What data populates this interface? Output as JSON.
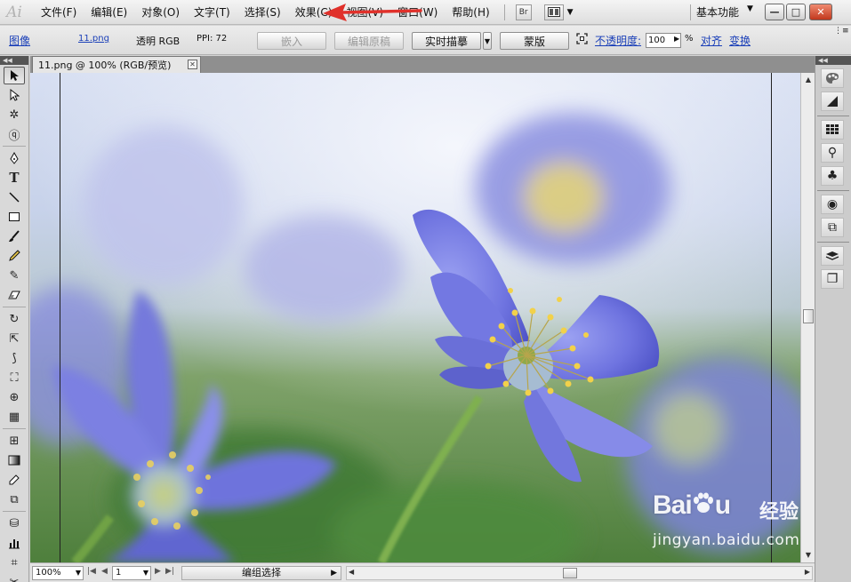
{
  "app": {
    "logo": "Ai"
  },
  "menubar": {
    "items": [
      "文件(F)",
      "编辑(E)",
      "对象(O)",
      "文字(T)",
      "选择(S)",
      "效果(C)",
      "视图(V)",
      "窗口(W)",
      "帮助(H)"
    ],
    "bridge_label": "Br",
    "workspace_label": "基本功能",
    "window_buttons": [
      "—",
      "□",
      "✕"
    ]
  },
  "controlbar": {
    "object_type": "图像",
    "file_link": "11.png",
    "color_info": "透明  RGB",
    "ppi": "PPI: 72",
    "embed_label": "嵌入",
    "edit_original_label": "编辑原稿",
    "live_trace_label": "实时描摹",
    "mask_label": "蒙版",
    "opacity_label": "不透明度:",
    "opacity_value": "100",
    "opacity_unit": "%",
    "align_label": "对齐",
    "transform_label": "变换"
  },
  "document": {
    "tab_title": "11.png @ 100% (RGB/预览)",
    "tab_close": "✕"
  },
  "watermark": {
    "brand": "Bai",
    "brand_end": "u",
    "jingyan": "经验",
    "url": "jingyan.baidu.com"
  },
  "statusbar": {
    "zoom": "100%",
    "artboard": "1",
    "status_text": "编组选择"
  },
  "colors": {
    "annotation_arrow": "#e0312b",
    "link_blue": "#1a3fb8",
    "flower_violet": "#6f74e0"
  }
}
